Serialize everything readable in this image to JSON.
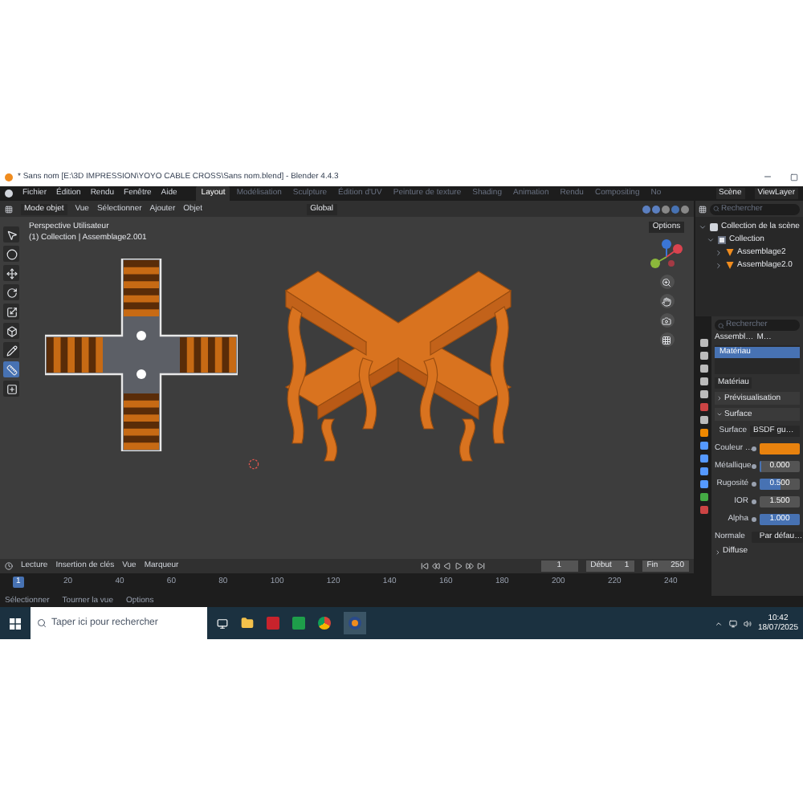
{
  "window": {
    "title": "* Sans nom [E:\\3D IMPRESSION\\YOYO CABLE CROSS\\Sans nom.blend] - Blender 4.4.3"
  },
  "menu": [
    "Fichier",
    "Édition",
    "Rendu",
    "Fenêtre",
    "Aide"
  ],
  "workspaces": [
    {
      "label": "Layout",
      "selected": true
    },
    {
      "label": "Modélisation",
      "selected": false
    },
    {
      "label": "Sculpture",
      "selected": false
    },
    {
      "label": "Édition d'UV",
      "selected": false
    },
    {
      "label": "Peinture de texture",
      "selected": false
    },
    {
      "label": "Shading",
      "selected": false
    },
    {
      "label": "Animation",
      "selected": false
    },
    {
      "label": "Rendu",
      "selected": false
    },
    {
      "label": "Compositing",
      "selected": false
    },
    {
      "label": "No",
      "selected": false
    }
  ],
  "scene": "Scène",
  "view_layer": "ViewLayer",
  "viewport": {
    "mode": "Mode objet",
    "menus": [
      "Vue",
      "Sélectionner",
      "Ajouter",
      "Objet"
    ],
    "orientation": "Global",
    "options": "Options",
    "perspective": "Perspective Utilisateur",
    "context": "(1) Collection | Assemblage2.001"
  },
  "outliner": {
    "search": {
      "placeholder": "Rechercher"
    },
    "items": [
      {
        "label": "Collection de la scène",
        "kind": "scene",
        "children": [
          {
            "label": "Collection",
            "kind": "collection",
            "children": [
              {
                "label": "Assemblage2",
                "kind": "object"
              },
              {
                "label": "Assemblage2.0",
                "kind": "object"
              }
            ]
          }
        ]
      }
    ]
  },
  "properties": {
    "search": {
      "placeholder": "Rechercher"
    },
    "breadcrumb": [
      "Assembl…",
      "M…"
    ],
    "slots": [
      {
        "label": "Matériau",
        "selected": true
      }
    ],
    "material": "Matériau",
    "panels": [
      {
        "label": "Prévisualisation",
        "expanded": false
      },
      {
        "label": "Surface",
        "expanded": true
      }
    ],
    "surface_label": "Surface",
    "surface": "BSDF gu…",
    "fields": [
      {
        "label": "Couleur …",
        "kind": "color",
        "color": "#e8820e"
      },
      {
        "label": "Métallique",
        "kind": "slider",
        "value": "0.000",
        "level": 0
      },
      {
        "label": "Rugosité",
        "kind": "slider",
        "value": "0.500",
        "level": 0.5
      },
      {
        "label": "IOR",
        "kind": "number",
        "value": "1.500"
      },
      {
        "label": "Alpha",
        "kind": "slider",
        "value": "1.000",
        "level": 1
      },
      {
        "label": "Normale",
        "kind": "link",
        "value": "Par défau…"
      }
    ],
    "subpanel": "Diffuse"
  },
  "timeline": {
    "menus": [
      "Lecture",
      "Insertion de clés",
      "Vue",
      "Marqueur"
    ],
    "frame": "1",
    "start_label": "Début",
    "start": "1",
    "end_label": "Fin",
    "end": "250",
    "ticks": [
      {
        "label": "1",
        "selected": true
      },
      {
        "label": "20",
        "selected": false
      },
      {
        "label": "40",
        "selected": false
      },
      {
        "label": "60",
        "selected": false
      },
      {
        "label": "80",
        "selected": false
      },
      {
        "label": "100",
        "selected": false
      },
      {
        "label": "120",
        "selected": false
      },
      {
        "label": "140",
        "selected": false
      },
      {
        "label": "160",
        "selected": false
      },
      {
        "label": "180",
        "selected": false
      },
      {
        "label": "200",
        "selected": false
      },
      {
        "label": "220",
        "selected": false
      },
      {
        "label": "240",
        "selected": false
      }
    ]
  },
  "status_bar": [
    "Sélectionner",
    "Tourner la vue",
    "Options"
  ],
  "taskbar": {
    "search": {
      "placeholder": "Taper ici pour rechercher"
    },
    "time": "10:42",
    "date": "18/07/2025"
  }
}
